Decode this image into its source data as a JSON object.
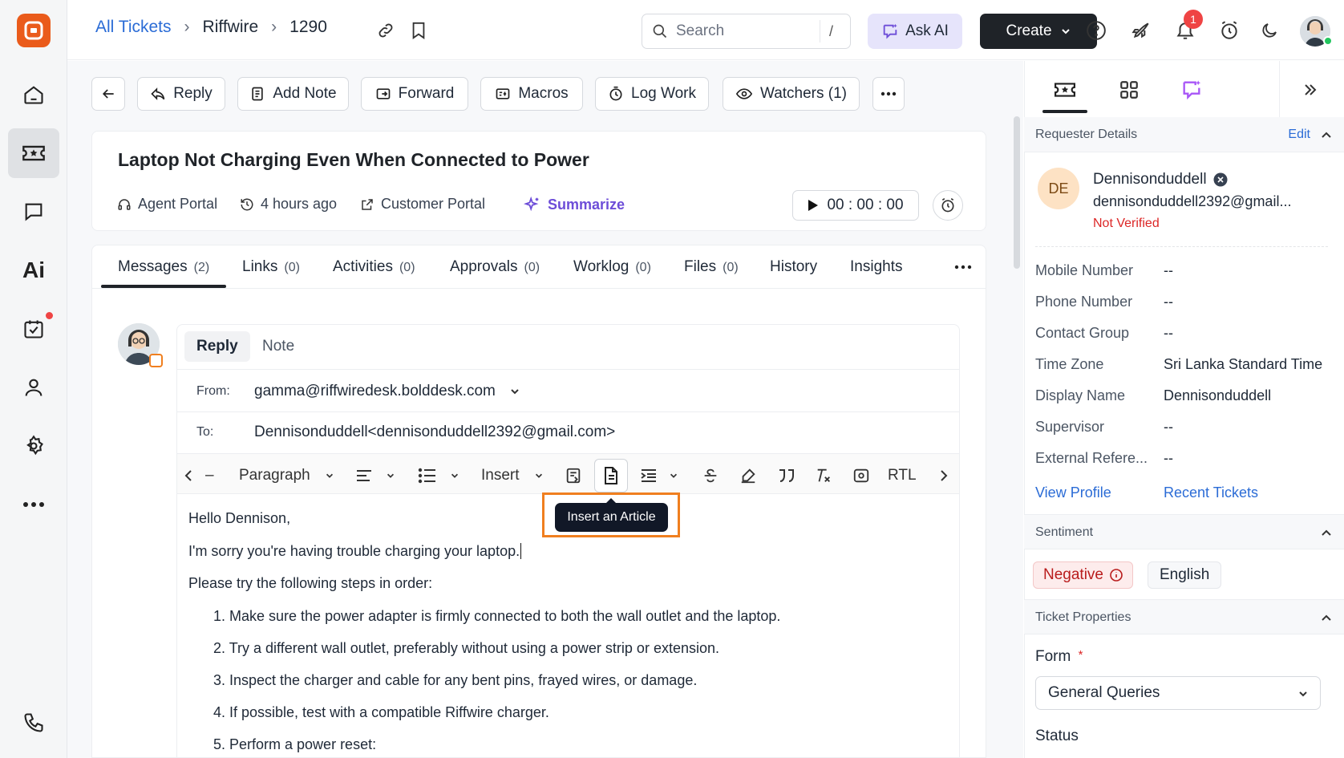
{
  "colors": {
    "brand": "#ea5b1b",
    "link": "#2b6cd6",
    "accent": "#6d4dd8",
    "highlight": "#f07f1f",
    "negative": "#dc2626"
  },
  "nav": {
    "icons": [
      "home-icon",
      "tickets-icon",
      "chat-icon",
      "ai-icon",
      "tasks-icon",
      "contacts-icon",
      "settings-icon",
      "more-icon",
      "phone-icon"
    ],
    "ai_label": "Ai"
  },
  "breadcrumb": {
    "all_tickets": "All Tickets",
    "brand": "Riffwire",
    "ticket_id": "1290"
  },
  "header": {
    "search_placeholder": "Search",
    "search_shortcut": "/",
    "ask_ai": "Ask AI",
    "create": "Create",
    "notification_count": "1"
  },
  "actions": {
    "reply": "Reply",
    "add_note": "Add Note",
    "forward": "Forward",
    "macros": "Macros",
    "log_work": "Log Work",
    "watchers": "Watchers (1)"
  },
  "ticket": {
    "title": "Laptop Not Charging Even When Connected to Power",
    "source": "Agent Portal",
    "time_ago": "4 hours ago",
    "portal": "Customer Portal",
    "summarize": "Summarize",
    "timer": "00 : 00 : 00"
  },
  "tabs": [
    {
      "label": "Messages",
      "count": "(2)"
    },
    {
      "label": "Links",
      "count": "(0)"
    },
    {
      "label": "Activities",
      "count": "(0)"
    },
    {
      "label": "Approvals",
      "count": "(0)"
    },
    {
      "label": "Worklog",
      "count": "(0)"
    },
    {
      "label": "Files",
      "count": "(0)"
    },
    {
      "label": "History",
      "count": ""
    },
    {
      "label": "Insights",
      "count": ""
    }
  ],
  "compose": {
    "reply_tab": "Reply",
    "note_tab": "Note",
    "from_label": "From:",
    "from_value": "gamma@riffwiredesk.bolddesk.com",
    "to_label": "To:",
    "to_value": "Dennisonduddell<dennisonduddell2392@gmail.com>",
    "toolbar": {
      "dash": "–",
      "paragraph": "Paragraph",
      "insert": "Insert",
      "rtl": "RTL"
    },
    "tooltip": "Insert an Article",
    "body": {
      "greeting": "Hello Dennison,",
      "line1": "I'm sorry you're having trouble charging your laptop.",
      "line2": "Please try the following steps in order:",
      "steps": [
        "1. Make sure the power adapter is firmly connected to both the wall outlet and the laptop.",
        "2. Try a different wall outlet, preferably without using a power strip or extension.",
        "3. Inspect the charger and cable for any bent pins, frayed wires, or damage.",
        "4. If possible, test with a compatible Riffwire charger.",
        "5. Perform a power reset:"
      ]
    }
  },
  "requester": {
    "section": "Requester Details",
    "edit": "Edit",
    "initials": "DE",
    "name": "Dennisonduddell",
    "email": "dennisonduddell2392@gmail...",
    "verified": "Not Verified",
    "fields": [
      {
        "key": "Mobile Number",
        "value": "--"
      },
      {
        "key": "Phone Number",
        "value": "--"
      },
      {
        "key": "Contact Group",
        "value": "--"
      },
      {
        "key": "Time Zone",
        "value": "Sri Lanka Standard Time"
      },
      {
        "key": "Display Name",
        "value": "Dennisonduddell"
      },
      {
        "key": "Supervisor",
        "value": "--"
      },
      {
        "key": "External Refere...",
        "value": "--"
      }
    ],
    "view_profile": "View Profile",
    "recent_tickets": "Recent Tickets"
  },
  "sentiment": {
    "section": "Sentiment",
    "value": "Negative",
    "language": "English"
  },
  "properties": {
    "section": "Ticket Properties",
    "form_label": "Form",
    "required": "*",
    "form_value": "General Queries",
    "status_label": "Status"
  }
}
